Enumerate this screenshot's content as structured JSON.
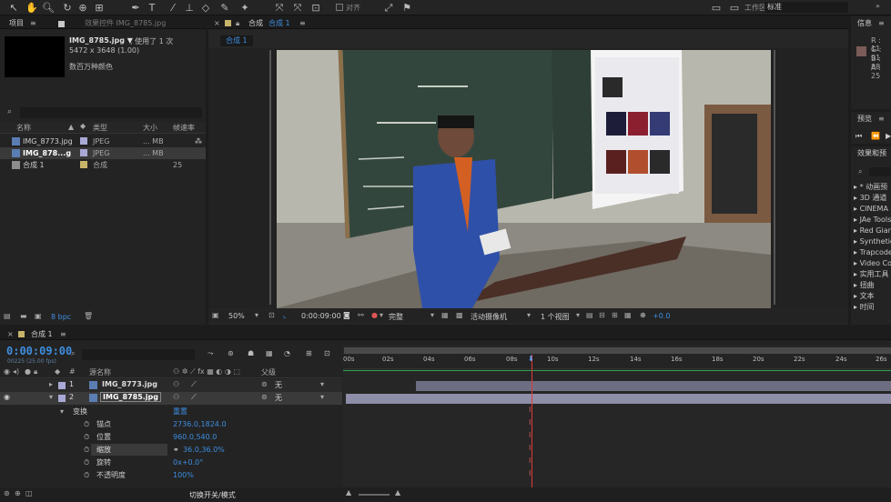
{
  "toolbar": {
    "checkbox_align_label": "对齐",
    "workspace_label": "工作区:",
    "workspace_value": "标准",
    "search_help_placeholder": "搜索帮助"
  },
  "project_panel": {
    "tab_label": "项目",
    "effects_tab_label": "效果控件 IMG_8785.jpg",
    "selected_name": "IMG_8785.jpg ▼",
    "used_count": ", 使用了 1 次",
    "dimensions": "5472 x 3648 (1.00)",
    "color_depth_desc": "数百万种颜色",
    "columns": [
      "名称",
      "类型",
      "大小",
      "帧速率"
    ],
    "items": [
      {
        "name": "IMG_8773.jpg",
        "type": "JPEG",
        "size": "... MB",
        "fps": ""
      },
      {
        "name": "IMG_878...g",
        "type": "JPEG",
        "size": "... MB",
        "fps": ""
      },
      {
        "name": "合成 1",
        "type": "合成",
        "size": "",
        "fps": "25"
      }
    ],
    "bpc": "8 bpc"
  },
  "comp_panel": {
    "tab_label": "合成",
    "tab_name": "合成 1",
    "sub_tab": "合成 1",
    "zoom": "50%",
    "timecode": "0:00:09:00",
    "resolution": "完整",
    "camera": "活动摄像机",
    "views": "1 个视图",
    "exposure": "+0.0"
  },
  "timeline": {
    "tab_label": "合成 1",
    "timecode": "0:00:09:00",
    "frame_info": "00225 (25.00 fps)",
    "layer_cols": {
      "num": "#",
      "source": "源名称",
      "parent": "父级"
    },
    "layers": [
      {
        "num": "1",
        "name": "IMG_8773.jpg",
        "parent": "无"
      },
      {
        "num": "2",
        "name": "IMG_8785.jpg",
        "parent": "无"
      }
    ],
    "transform_label": "变换",
    "reset_label": "重置",
    "props": [
      {
        "label": "锚点",
        "value": "2736.0,1824.0"
      },
      {
        "label": "位置",
        "value": "960.0,540.0"
      },
      {
        "label": "缩放",
        "value": "36.0,36.0%"
      },
      {
        "label": "旋转",
        "value": "0x+0.0°"
      },
      {
        "label": "不透明度",
        "value": "100%"
      }
    ],
    "ruler": [
      "00s",
      "02s",
      "04s",
      "06s",
      "08s",
      "10s",
      "12s",
      "14s",
      "16s",
      "18s",
      "20s",
      "22s",
      "24s",
      "26s"
    ],
    "toggle_mode": "切换开关/模式"
  },
  "info_panel": {
    "tab_label": "信息",
    "r": "R : 11",
    "g": "G : 91",
    "b": "B : 88",
    "a": "A : 25",
    "color": "#7a5b57"
  },
  "preview_panel": {
    "tab_label": "预览"
  },
  "effects_panel": {
    "tab_label": "效果和预",
    "items": [
      "* 动画预",
      "3D 通道",
      "CINEMA 4",
      "JAe Tools",
      "Red Giant",
      "Synthetic",
      "Trapcode",
      "Video Cop",
      "实用工具",
      "扭曲",
      "文本",
      "时间"
    ]
  }
}
